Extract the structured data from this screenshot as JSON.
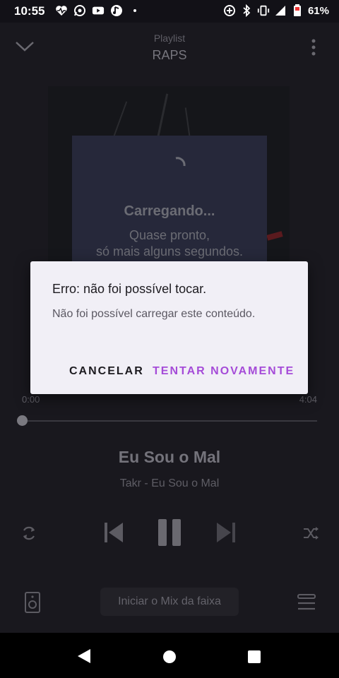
{
  "status_bar": {
    "time": "10:55",
    "battery_text": "61%",
    "left_icons": [
      "heart-rate-icon",
      "whatsapp-icon",
      "youtube-icon",
      "music-app-icon",
      "dot-icon"
    ],
    "right_icons": [
      "data-saver-icon",
      "bluetooth-icon",
      "vibrate-icon",
      "signal-icon",
      "battery-icon"
    ]
  },
  "header": {
    "subtitle": "Playlist",
    "title": "RAPS"
  },
  "loading": {
    "title": "Carregando...",
    "line1": "Quase pronto,",
    "line2": "só mais alguns segundos."
  },
  "track": {
    "elapsed": "0:00",
    "duration": "4:04",
    "progress": 0,
    "song_title": "Eu Sou o Mal",
    "artist_line": "Takr - Eu Sou o Mal"
  },
  "footer": {
    "mix_button_label": "Iniciar o Mix da faixa"
  },
  "dialog": {
    "title": "Erro: não foi possível tocar.",
    "message": "Não foi possível carregar este conteúdo.",
    "cancel_label": "CANCELAR",
    "retry_label": "TENTAR NOVAMENTE",
    "accent_color": "#a54bd8"
  }
}
